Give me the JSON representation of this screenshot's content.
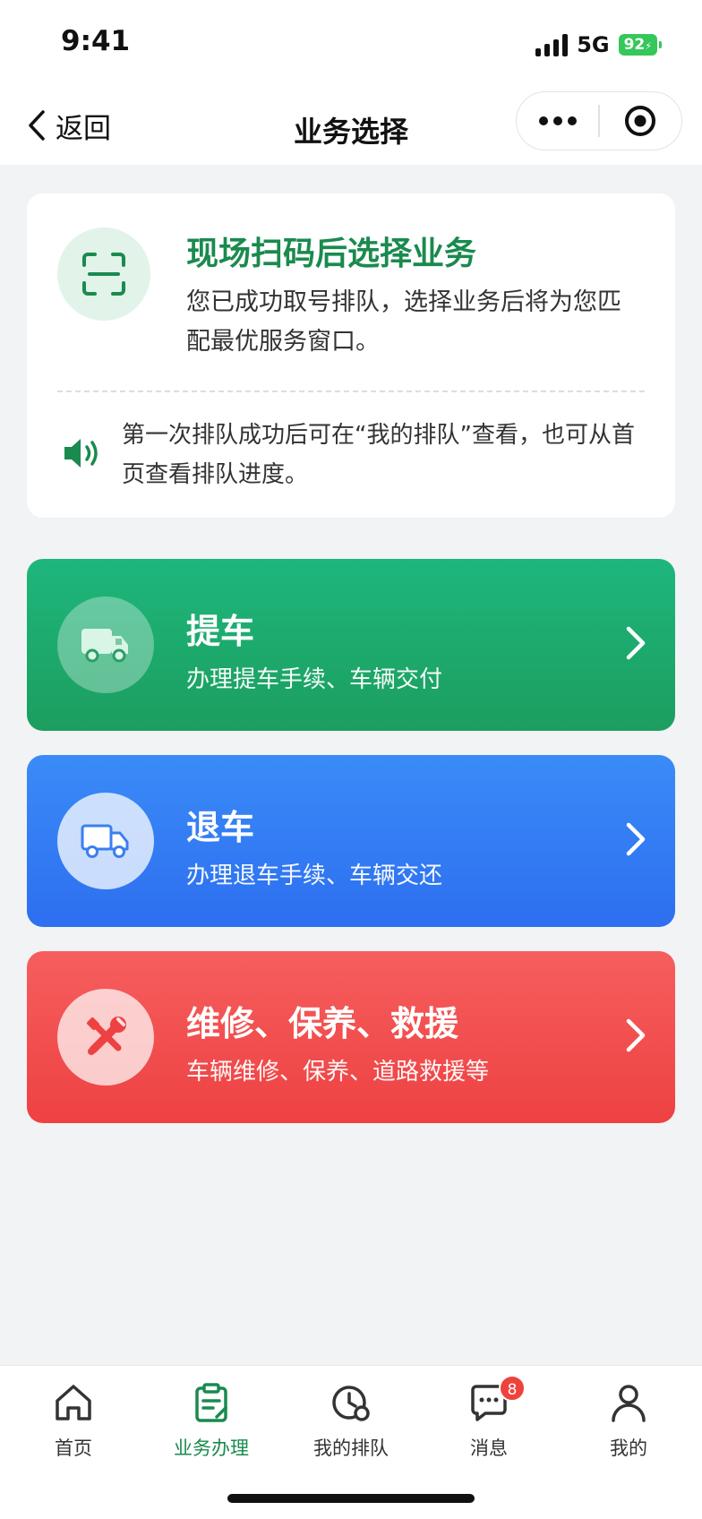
{
  "status_bar": {
    "time": "9:41",
    "network": "5G",
    "battery": "92"
  },
  "nav": {
    "back_label": "返回",
    "title": "业务选择"
  },
  "info_card": {
    "title": "现场扫码后选择业务",
    "desc": "您已成功取号排队，选择业务后将为您匹配最优服务窗口。",
    "notice": "第一次排队成功后可在“我的排队”查看，也可从首页查看排队进度。"
  },
  "services": [
    {
      "title": "提车",
      "subtitle": "办理提车手续、车辆交付",
      "icon": "truck-icon",
      "color": "#1eb67c"
    },
    {
      "title": "退车",
      "subtitle": "办理退车手续、车辆交还",
      "icon": "truck-icon",
      "color": "#3a8bf7"
    },
    {
      "title": "维修、保养、救援",
      "subtitle": "车辆维修、保养、道路救援等",
      "icon": "tools-icon",
      "color": "#f65e5e"
    }
  ],
  "tabs": [
    {
      "label": "首页",
      "icon": "home-icon"
    },
    {
      "label": "业务办理",
      "icon": "clipboard-icon",
      "active": true
    },
    {
      "label": "我的排队",
      "icon": "clock-icon"
    },
    {
      "label": "消息",
      "icon": "chat-icon",
      "badge": "8"
    },
    {
      "label": "我的",
      "icon": "user-icon"
    }
  ],
  "colors": {
    "brand_green": "#1a8a4e",
    "badge_red": "#f0423d"
  }
}
